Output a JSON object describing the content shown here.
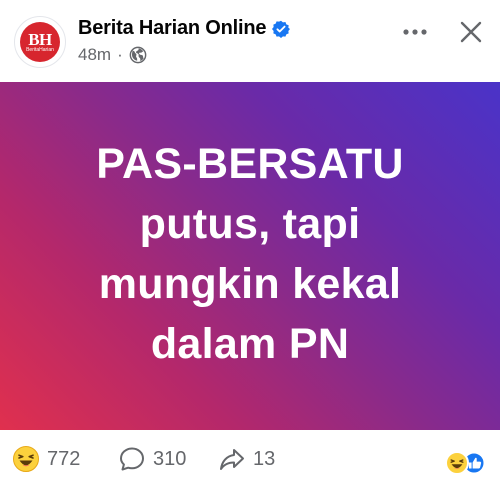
{
  "post": {
    "page_name": "Berita Harian Online",
    "time_ago": "48m",
    "separator": "·",
    "avatar": {
      "logo_text": "BH",
      "logo_subtext": "BeritaHarian"
    },
    "headline_lines": [
      "PAS-BERSATU",
      "putus, tapi",
      "mungkin kekal",
      "dalam PN"
    ]
  },
  "stats": {
    "reactions": "772",
    "comments": "310",
    "shares": "13"
  },
  "icons": {
    "verified": "verified-badge-icon",
    "audience": "globe-icon",
    "more": "more-options-icon",
    "close": "close-icon",
    "reaction": "haha-emoji-icon",
    "comment": "comment-bubble-icon",
    "share": "share-arrow-icon"
  },
  "colors": {
    "brand_blue": "#1877f2",
    "gradient_start": "#e0304e",
    "gradient_end": "#4a33c8",
    "meta_gray": "#65676b"
  }
}
